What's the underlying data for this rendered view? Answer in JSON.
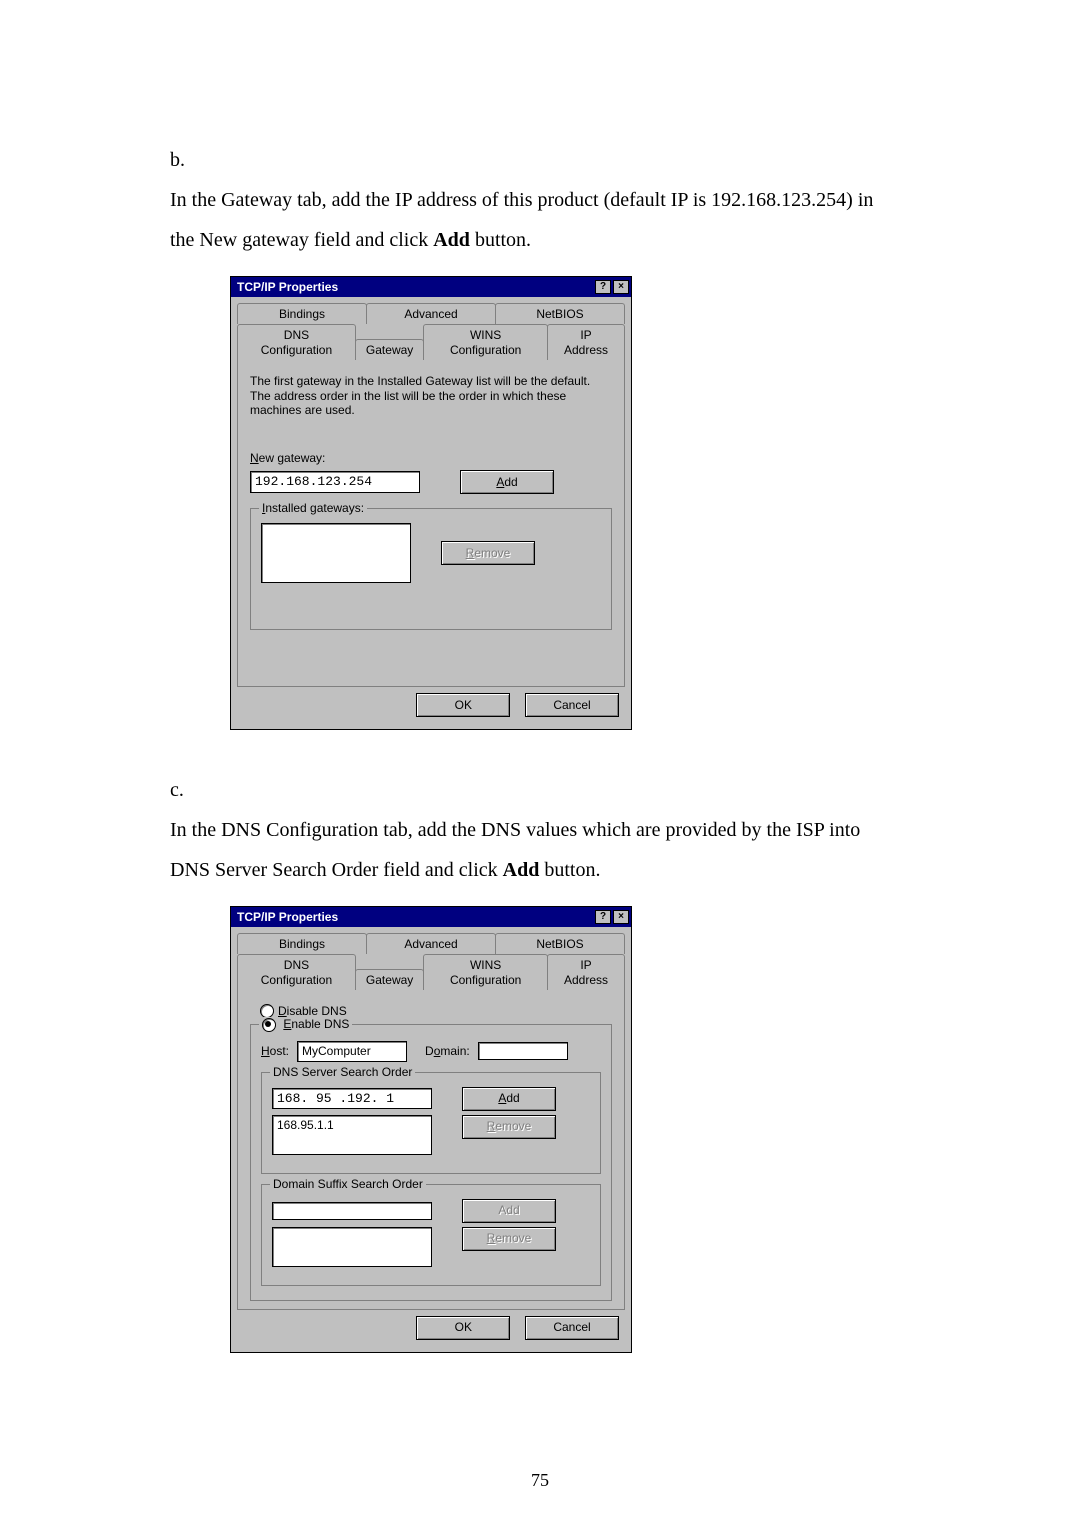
{
  "page_number": "75",
  "items": {
    "b": {
      "letter": "b.",
      "text_prefix": "In the Gateway tab, add the IP address of this product (default IP is 192.168.123.254) in the New gateway field and click ",
      "bold": "Add",
      "text_suffix": " button."
    },
    "c": {
      "letter": "c.",
      "text_prefix": "In the DNS Configuration tab, add the DNS values which are provided by the ISP into DNS Server Search Order field and click ",
      "bold": "Add",
      "text_suffix": " button."
    }
  },
  "dialog1": {
    "title": "TCP/IP Properties",
    "help_glyph": "?",
    "close_glyph": "×",
    "tabs_row1": [
      "Bindings",
      "Advanced",
      "NetBIOS"
    ],
    "tabs_row2": [
      "DNS Configuration",
      "Gateway",
      "WINS Configuration",
      "IP Address"
    ],
    "active_tab": "Gateway",
    "info_text": "The first gateway in the Installed Gateway list will be the default. The address order in the list will be the order in which these machines are used.",
    "new_gateway_label_un": "N",
    "new_gateway_label_rest": "ew gateway:",
    "new_gateway_value": "192.168.123.254",
    "add_label_un": "A",
    "add_label_rest": "dd",
    "installed_label_un": "I",
    "installed_label_rest": "nstalled gateways:",
    "remove_label_un": "R",
    "remove_label_rest": "emove",
    "ok_label": "OK",
    "cancel_label": "Cancel"
  },
  "dialog2": {
    "title": "TCP/IP Properties",
    "help_glyph": "?",
    "close_glyph": "×",
    "tabs_row1": [
      "Bindings",
      "Advanced",
      "NetBIOS"
    ],
    "tabs_row2": [
      "DNS Configuration",
      "Gateway",
      "WINS Configuration",
      "IP Address"
    ],
    "active_tab": "DNS Configuration",
    "disable_un": "D",
    "disable_rest": "isable DNS",
    "enable_un": "E",
    "enable_rest": "nable DNS",
    "host_un": "H",
    "host_rest": "ost:",
    "host_value": "MyComputer",
    "domain_un": "o",
    "domain_pre": "D",
    "domain_rest": "main:",
    "domain_value": "",
    "dns_order_label": "DNS Server Search Order",
    "dns_input_value": "168. 95 .192.  1",
    "dns_list_value": "168.95.1.1",
    "add_un": "A",
    "add_rest": "dd",
    "remove_un": "R",
    "remove_rest": "emove",
    "suffix_label": "Domain Suffix Search Order",
    "suffix_input_value": "",
    "suffix_add_label": "Add",
    "suffix_remove_label_un": "R",
    "suffix_remove_label_rest": "emove",
    "ok_label": "OK",
    "cancel_label": "Cancel"
  }
}
